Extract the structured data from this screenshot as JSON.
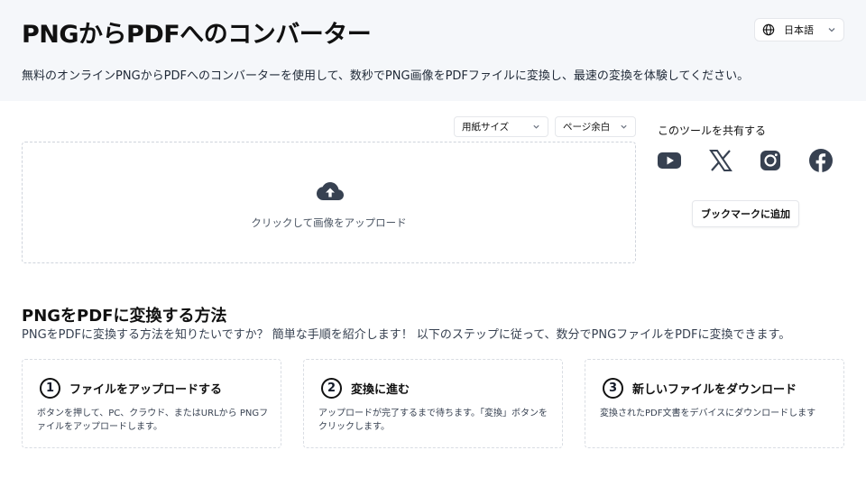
{
  "header": {
    "title": "PNGからPDFへのコンバーター",
    "subtitle": "無料のオンラインPNGからPDFへのコンバーターを使用して、数秒でPNG画像をPDFファイルに変換し、最速の変換を体験してください。",
    "language": "日本語"
  },
  "options": {
    "paper_size": "用紙サイズ",
    "page_margin": "ページ余白"
  },
  "upload": {
    "label": "クリックして画像をアップロード"
  },
  "share": {
    "title": "このツールを共有する",
    "icons": [
      "youtube-icon",
      "x-icon",
      "instagram-icon",
      "facebook-icon"
    ],
    "bookmark_label": "ブックマークに追加"
  },
  "howto": {
    "title": "PNGをPDFに変換する方法",
    "description": "PNGをPDFに変換する方法を知りたいですか？ 簡単な手順を紹介します！ 以下のステップに従って、数分でPNGファイルをPDFに変換できます。",
    "steps": [
      {
        "number": "1",
        "title": "ファイルをアップロードする",
        "text": "ボタンを押して、PC、クラウド、またはURLから PNGファイルをアップロードします。"
      },
      {
        "number": "2",
        "title": "変換に進む",
        "text": "アップロードが完了するまで待ちます。「変換」ボタンをクリックします。"
      },
      {
        "number": "3",
        "title": "新しいファイルをダウンロード",
        "text": "変換されたPDF文書をデバイスにダウンロードします"
      }
    ]
  },
  "colors": {
    "hero_bg": "#f5f7fa",
    "icon": "#374151",
    "border_dashed": "#cfd4dc"
  }
}
